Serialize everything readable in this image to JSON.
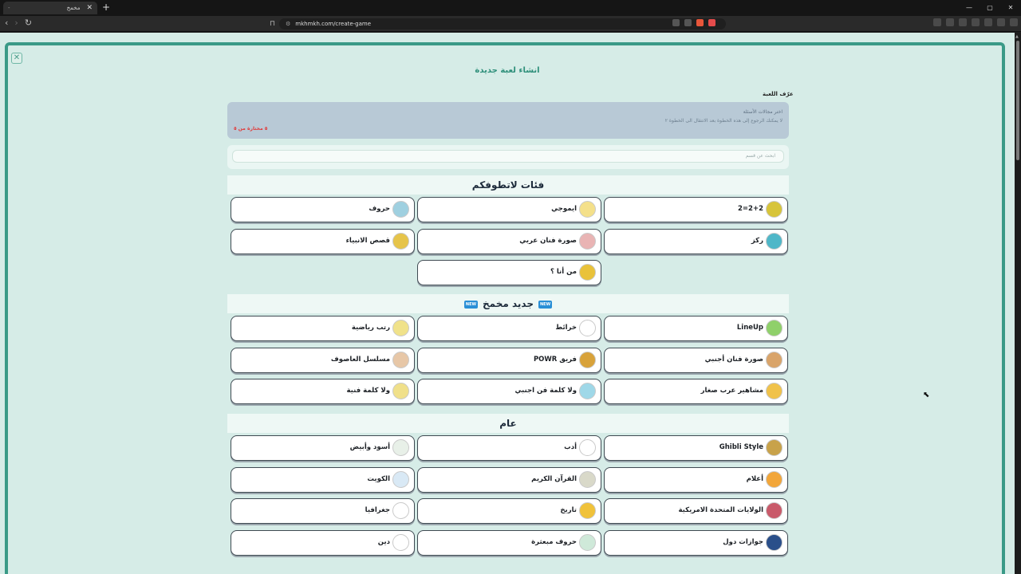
{
  "browser": {
    "tab_title": "مخمخ",
    "tab_dash": "-",
    "new_tab": "+",
    "url": "mkhmkh.com/create-game",
    "window_controls": [
      "—",
      "▢",
      "✕"
    ]
  },
  "page": {
    "title": "انشاء لعبة جديدة",
    "section_label": "عرّف اللعبة",
    "info": {
      "line1": "اختر مجالات الأسئلة",
      "line2": "لا يمكنك الرجوع إلى هذه الخطوة بعد الانتقال الى الخطوة ٢",
      "counter": "٥ مختارة من ٥"
    },
    "search_placeholder": "ابحث عن قسم"
  },
  "categories": [
    {
      "heading": "فئات لاتطوفكم",
      "new_badges": false,
      "items": [
        {
          "label": "2+2=2",
          "icon": "grid-icon",
          "color": "#d7c43a"
        },
        {
          "label": "ايموجي",
          "icon": "emoji-icon",
          "color": "#f4e08a"
        },
        {
          "label": "حروف",
          "icon": "letters-icon",
          "color": "#9fd0e0"
        },
        {
          "label": "ركز",
          "icon": "focus-icon",
          "color": "#4fb7c8"
        },
        {
          "label": "صورة فنان عربي",
          "icon": "artist-photo-icon",
          "color": "#e9b4b4"
        },
        {
          "label": "قصص الانبياء",
          "icon": "book-icon",
          "color": "#e6c44a"
        },
        {
          "label": "من أنا ؟",
          "icon": "person-silhouette-icon",
          "color": "#e9c23a"
        }
      ]
    },
    {
      "heading": "جديد مخمخ",
      "new_badges": true,
      "new_label": "NEW",
      "items": [
        {
          "label": "LineUp",
          "icon": "lineup-icon",
          "color": "#8fd06a"
        },
        {
          "label": "خرائط",
          "icon": "map-icon",
          "color": "#ffffff"
        },
        {
          "label": "رتب رياضية",
          "icon": "sports-icon",
          "color": "#f0e28a"
        },
        {
          "label": "صورة فنان أجنبي",
          "icon": "foreign-artist-icon",
          "color": "#d9a46a"
        },
        {
          "label": "فريق POWR",
          "icon": "team-icon",
          "color": "#d8a23a"
        },
        {
          "label": "مسلسل العاصوف",
          "icon": "series-icon",
          "color": "#e7c7a7"
        },
        {
          "label": "مشاهير عرب صغار",
          "icon": "celebrity-icon",
          "color": "#f0c24a"
        },
        {
          "label": "ولا كلمة فن اجنبي",
          "icon": "charades-icon",
          "color": "#9fd8e8"
        },
        {
          "label": "ولا كلمة فنية",
          "icon": "charades-art-icon",
          "color": "#f0e08a"
        }
      ]
    },
    {
      "heading": "عام",
      "new_badges": false,
      "items": [
        {
          "label": "Ghibli Style",
          "icon": "ghibli-icon",
          "color": "#c8a24a"
        },
        {
          "label": "أدب",
          "icon": "literature-icon",
          "color": "#ffffff"
        },
        {
          "label": "أسود وأبيض",
          "icon": "black-white-icon",
          "color": "#e8f0e8"
        },
        {
          "label": "أعلام",
          "icon": "flag-icon",
          "color": "#f2a63a"
        },
        {
          "label": "القرآن الكريم",
          "icon": "quran-icon",
          "color": "#d9d9c9"
        },
        {
          "label": "الكويت",
          "icon": "kuwait-icon",
          "color": "#d9e9f5"
        },
        {
          "label": "الولايات المتحدة الامريكية",
          "icon": "usa-flag-icon",
          "color": "#c95a6a"
        },
        {
          "label": "تاريخ",
          "icon": "history-icon",
          "color": "#f0c23a"
        },
        {
          "label": "جغرافيا",
          "icon": "location-pin-icon",
          "color": "#ffffff"
        },
        {
          "label": "جوازات دول",
          "icon": "passport-icon",
          "color": "#2a4f8a"
        },
        {
          "label": "حروف مبعثرة",
          "icon": "scrambled-letters-icon",
          "color": "#cfe9d9"
        },
        {
          "label": "دين",
          "icon": "religion-icon",
          "color": "#ffffff"
        }
      ]
    }
  ]
}
